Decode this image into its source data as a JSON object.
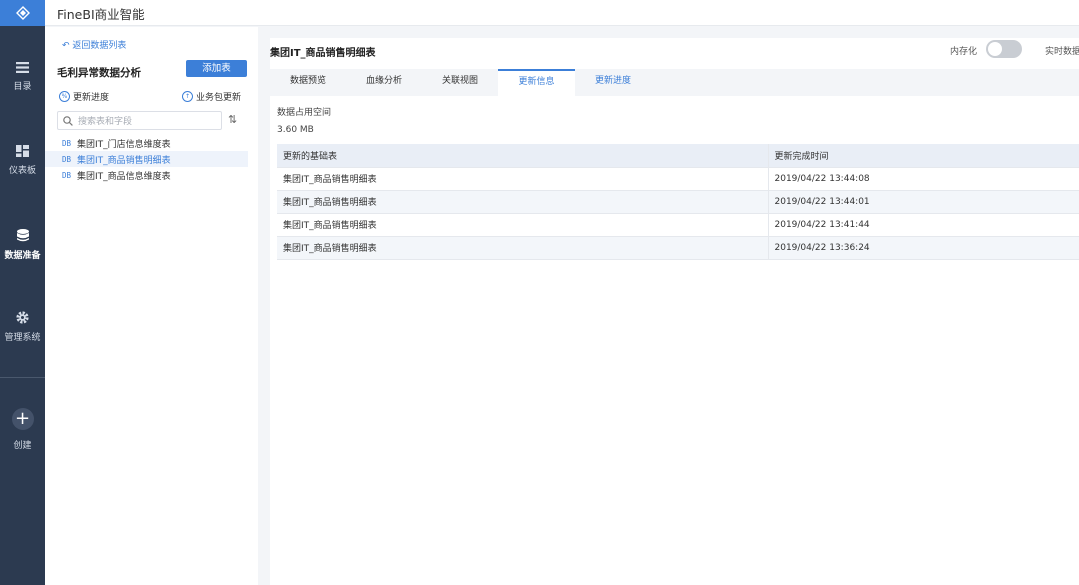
{
  "app": {
    "brand": "FineBI商业智能"
  },
  "nav": {
    "items": [
      {
        "label": "目录",
        "icon": "menu-list-icon"
      },
      {
        "label": "仪表板",
        "icon": "dashboard-icon"
      },
      {
        "label": "数据准备",
        "icon": "database-icon"
      },
      {
        "label": "管理系统",
        "icon": "gear-icon"
      },
      {
        "label": "创建",
        "icon": "plus-icon"
      }
    ]
  },
  "left_panel": {
    "back_link": "返回数据列表",
    "title": "毛利异常数据分析",
    "add_button": "添加表",
    "update_progress": "更新进度",
    "package_update": "业务包更新",
    "search_placeholder": "搜索表和字段",
    "tables": [
      {
        "tag": "DB",
        "name": "集团IT_门店信息维度表"
      },
      {
        "tag": "DB",
        "name": "集团IT_商品销售明细表"
      },
      {
        "tag": "DB",
        "name": "集团IT_商品信息维度表"
      }
    ]
  },
  "main": {
    "title": "集团IT_商品销售明细表",
    "memory_label": "内存化",
    "realtime_label": "实时数据",
    "tabs": [
      "数据预览",
      "血缘分析",
      "关联视图",
      "更新信息",
      "更新进度"
    ],
    "active_tab": "更新信息",
    "occupancy_label": "数据占用空间",
    "occupancy_value": "3.60 MB",
    "table": {
      "headers": [
        "更新的基础表",
        "更新完成时间"
      ],
      "rows": [
        [
          "集团IT_商品销售明细表",
          "2019/04/22 13:44:08"
        ],
        [
          "集团IT_商品销售明细表",
          "2019/04/22 13:44:01"
        ],
        [
          "集团IT_商品销售明细表",
          "2019/04/22 13:41:44"
        ],
        [
          "集团IT_商品销售明细表",
          "2019/04/22 13:36:24"
        ]
      ]
    }
  },
  "colors": {
    "accent": "#3c7fd8",
    "nav_bg": "#2c3a50"
  }
}
